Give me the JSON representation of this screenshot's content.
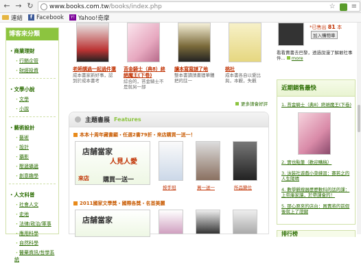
{
  "browser": {
    "url_host": "www.books.com.tw",
    "url_path": "/books/index.php",
    "bookmarks": [
      {
        "label": "連結",
        "icon": "folder-icon"
      },
      {
        "label": "Facebook",
        "icon": "facebook-icon"
      },
      {
        "label": "Yahoo!奇摩",
        "icon": "yahoo-icon"
      }
    ]
  },
  "sidebar": {
    "title": "博客來分類",
    "categories": [
      {
        "title": "商業理財",
        "items": [
          "行銷企管",
          "財經投資"
        ]
      },
      {
        "title": "文學小說",
        "items": [
          "文學",
          "小說"
        ]
      },
      {
        "title": "藝術設計",
        "items": [
          "藝術",
          "設計",
          "攝影",
          "壓遞攝遞",
          "創意趣學"
        ]
      },
      {
        "title": "人文科普",
        "items": [
          "社會人文",
          "史地",
          "法律/政治/軍事",
          "應用科學",
          "自然科學",
          "醫藥資訊/哲學系統"
        ]
      }
    ]
  },
  "center": {
    "products": [
      {
        "name": "老師講過一起過件還",
        "desc": "成本書家新好事，認到於成本書考"
      },
      {
        "name": "苔金騎士（典8）終絕魔王(下卷)",
        "desc": "綜合的，苔金騎士不是就另一部"
      },
      {
        "name": "讀本寫寫謎了地",
        "desc": "整本書讀請畫貍華體把的註一"
      },
      {
        "name": "桃社",
        "desc": "成本書各自以愛比與，本觀，失觀"
      }
    ],
    "more_label": "更多請會好評",
    "featured": {
      "title": "主題書展",
      "subtitle": "Features",
      "promo1": "本本十周年藏書顯・任選2書79折・來店購買一送一！",
      "promo2": "2011國家文學獎・國際各獎・名首美麗",
      "banner1": {
        "line1": "店舗當家",
        "line2": "人見人愛",
        "line3": "來店",
        "line4": "購買一送一"
      },
      "books1": [
        {
          "caption": "按手冠"
        },
        {
          "caption": "買一送一"
        },
        {
          "caption": "所品變位"
        }
      ]
    }
  },
  "right": {
    "price_label": "*已售出",
    "price_value": "81",
    "price_unit": "本",
    "cart_label": "加入購物車",
    "note": "看看賣書去巴黎，透過說漫了解敢社事件...",
    "note_more": "more",
    "ranking_title": "近期銷售最快",
    "ranking": [
      "1. 苔金騎士（典8）終絕魔王(下卷)",
      "2. 實也點筆（歡迎購稿）",
      "3. 泳裝社遊戲小菜練習：賽若之的人生陽晴",
      "4. 數學觀搜器歷歷數科的話的課：上帝庫家讓，於帶課會的！",
      "5. 那心原來的店台：買賣將的前假後就上了證鍵"
    ],
    "ranking2_title": "排行榜"
  }
}
